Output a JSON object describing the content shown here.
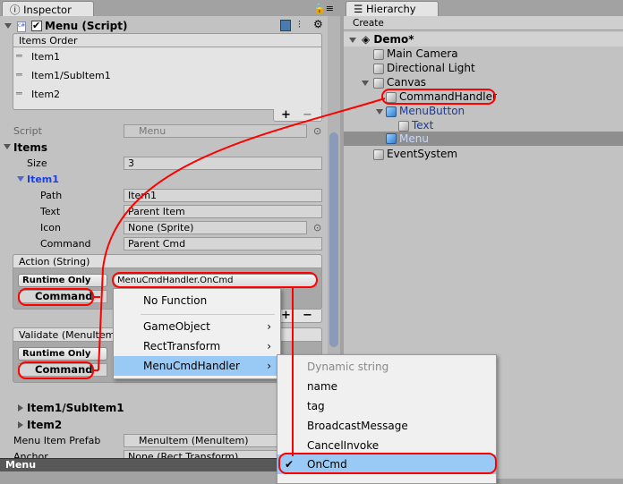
{
  "inspector": {
    "tab": "Inspector",
    "component_title": "Menu (Script)",
    "items_order": {
      "header": "Items Order",
      "items": [
        "Item1",
        "Item1/SubItem1",
        "Item2"
      ]
    },
    "script_label": "Script",
    "script_value": "Menu",
    "items_label": "Items",
    "size_label": "Size",
    "size_value": "3",
    "item1_label": "Item1",
    "path_label": "Path",
    "path_value": "Item1",
    "text_label": "Text",
    "text_value": "Parent Item",
    "icon_label": "Icon",
    "icon_value": "None (Sprite)",
    "command_label": "Command",
    "command_value": "Parent Cmd",
    "action": {
      "header": "Action (String)",
      "runtime": "Runtime Only",
      "function": "MenuCmdHandler.OnCmd",
      "object": "Command"
    },
    "validate": {
      "header": "Validate (MenuItem",
      "runtime": "Runtime Only",
      "object": "Command"
    },
    "subitem_label": "Item1/SubItem1",
    "item2_label": "Item2",
    "prefab_label": "Menu Item Prefab",
    "prefab_value": "MenuItem (MenuItem)",
    "anchor_label": "Anchor",
    "anchor_value": "None (Rect Transform)",
    "bottom_label": "Menu",
    "plus": "+",
    "minus": "−"
  },
  "dropdown": {
    "items": [
      "No Function",
      "GameObject",
      "RectTransform",
      "MenuCmdHandler"
    ]
  },
  "submenu": {
    "header": "Dynamic string",
    "items": [
      "name",
      "tag",
      "BroadcastMessage",
      "CancelInvoke",
      "OnCmd"
    ],
    "checked": "OnCmd"
  },
  "hierarchy": {
    "tab": "Hierarchy",
    "create": "Create",
    "scene": "Demo*",
    "items": [
      "Main Camera",
      "Directional Light",
      "Canvas",
      "CommandHandler",
      "MenuButton",
      "Text",
      "Menu",
      "EventSystem"
    ]
  },
  "colors": {
    "annotation": "#ff0000",
    "selection": "#99c9f5",
    "prefab_text": "#1a3a9a"
  }
}
